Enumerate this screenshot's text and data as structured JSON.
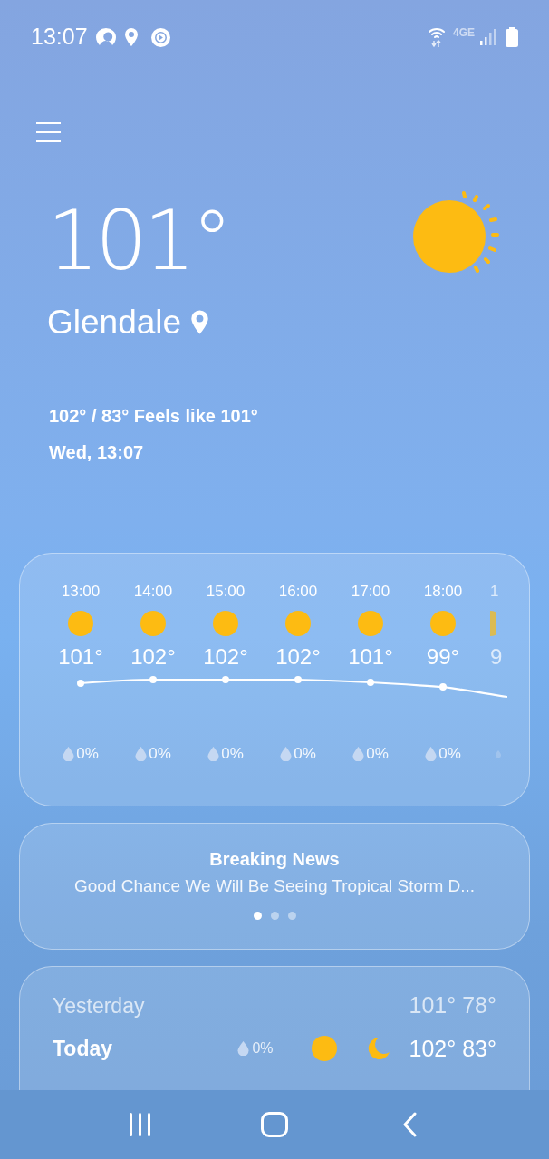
{
  "status_bar": {
    "time": "13:07",
    "network": "4GE"
  },
  "current": {
    "temperature": "101°",
    "location": "Glendale",
    "high_low_feels": "102° / 83° Feels like 101°",
    "date_time": "Wed, 13:07"
  },
  "hourly": [
    {
      "time": "13:00",
      "temp": "101°",
      "precip": "0%",
      "faded": false
    },
    {
      "time": "14:00",
      "temp": "102°",
      "precip": "0%",
      "faded": false
    },
    {
      "time": "15:00",
      "temp": "102°",
      "precip": "0%",
      "faded": false
    },
    {
      "time": "16:00",
      "temp": "102°",
      "precip": "0%",
      "faded": false
    },
    {
      "time": "17:00",
      "temp": "101°",
      "precip": "0%",
      "faded": false
    },
    {
      "time": "18:00",
      "temp": "99°",
      "precip": "0%",
      "faded": false
    },
    {
      "time": "1",
      "temp": "9",
      "faded": true
    }
  ],
  "news": {
    "title": "Breaking News",
    "headline": "Good Chance We Will Be Seeing Tropical Storm D...",
    "pages": [
      {
        "selected": true
      },
      {
        "selected": false
      },
      {
        "selected": false
      }
    ]
  },
  "daily": [
    {
      "day": "Yesterday",
      "past": true,
      "temps": "101° 78°"
    },
    {
      "day": "Today",
      "past": false,
      "precip": "0%",
      "temps": "102° 83°"
    }
  ]
}
